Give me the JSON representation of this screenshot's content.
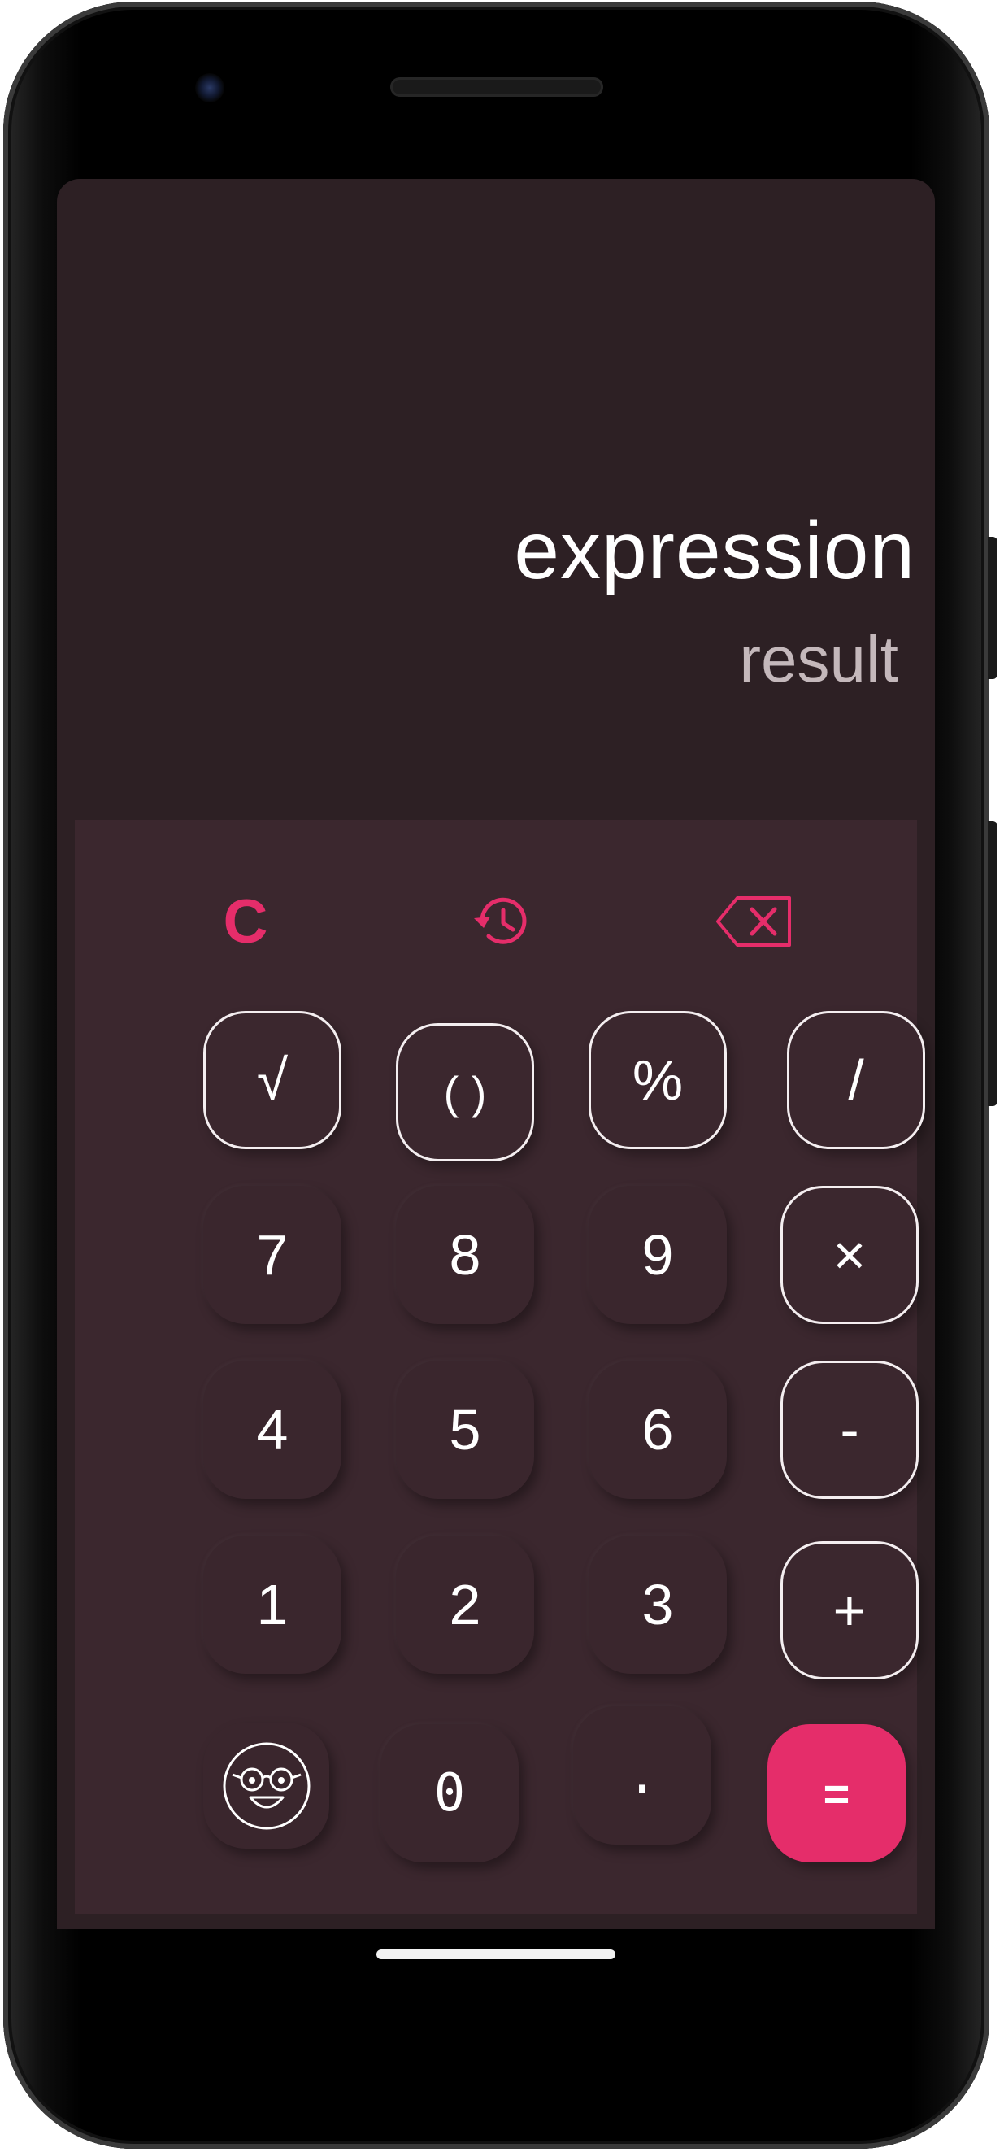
{
  "display": {
    "expression": "expression",
    "result": "result"
  },
  "actions": {
    "clear_label": "C",
    "history_icon": "history-icon",
    "backspace_icon": "backspace-icon"
  },
  "keys": {
    "sqrt": "√",
    "parentheses": "( )",
    "percent": "%",
    "divide": "/",
    "seven": "7",
    "eight": "8",
    "nine": "9",
    "multiply": "×",
    "four": "4",
    "five": "5",
    "six": "6",
    "minus": "-",
    "one": "1",
    "two": "2",
    "three": "3",
    "plus": "+",
    "zero": "0",
    "decimal": ".",
    "equals": "=",
    "emoji_icon": "nerd-face-icon"
  },
  "colors": {
    "accent": "#e52d6a",
    "background": "#2d2024",
    "keypad_background": "#3b272e",
    "result_text": "#c4b8bb"
  }
}
